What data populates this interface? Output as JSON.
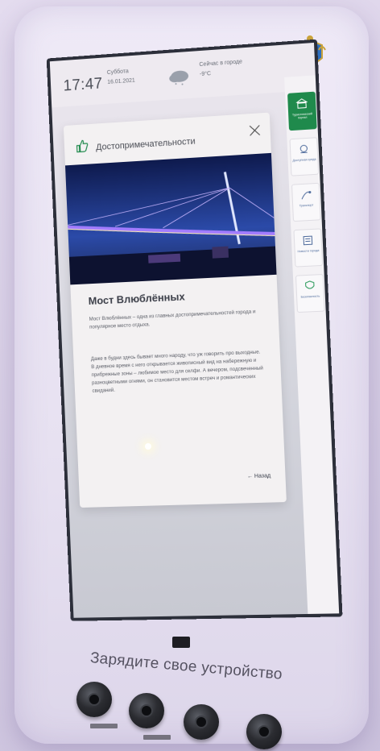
{
  "kiosk": {
    "charge_label": "Зарядите свое устройство"
  },
  "screen": {
    "time": "17:47",
    "day": "Суббота",
    "date": "16.01.2021",
    "weather_label": "Сейчас в городе",
    "weather_temp": "-9°С",
    "weather_icon": "cloud-snow-icon"
  },
  "sidebar": {
    "items": [
      {
        "label": "Туристический портал",
        "icon": "museum-icon",
        "active": true
      },
      {
        "label": "Доступная среда",
        "icon": "accessibility-icon",
        "active": false
      },
      {
        "label": "Транспорт",
        "icon": "route-icon",
        "active": false
      },
      {
        "label": "Новости города",
        "icon": "news-icon",
        "active": false
      },
      {
        "label": "Безопасность",
        "icon": "shield-icon",
        "active": false
      }
    ]
  },
  "modal": {
    "title": "Достопримечательности",
    "heading": "Мост Влюблённых",
    "paragraph1": "Мост Влюблённых – одна из главных достопримечательностей города и популярное место отдыха.",
    "paragraph2": "Даже в будни здесь бывает много народу, что уж говорить про выходные. В дневное время с него открывается живописный вид на набережную и прибрежные зоны – любимое место для селфи. А вечером, подсвеченный разноцветными огнями, он становится местом встреч и романтических свиданий.",
    "back_label": "← Назад"
  },
  "colors": {
    "accent_green": "#1f8a4c",
    "screen_bg": "#eeeaf0",
    "kiosk_body": "#e7e1f1"
  }
}
